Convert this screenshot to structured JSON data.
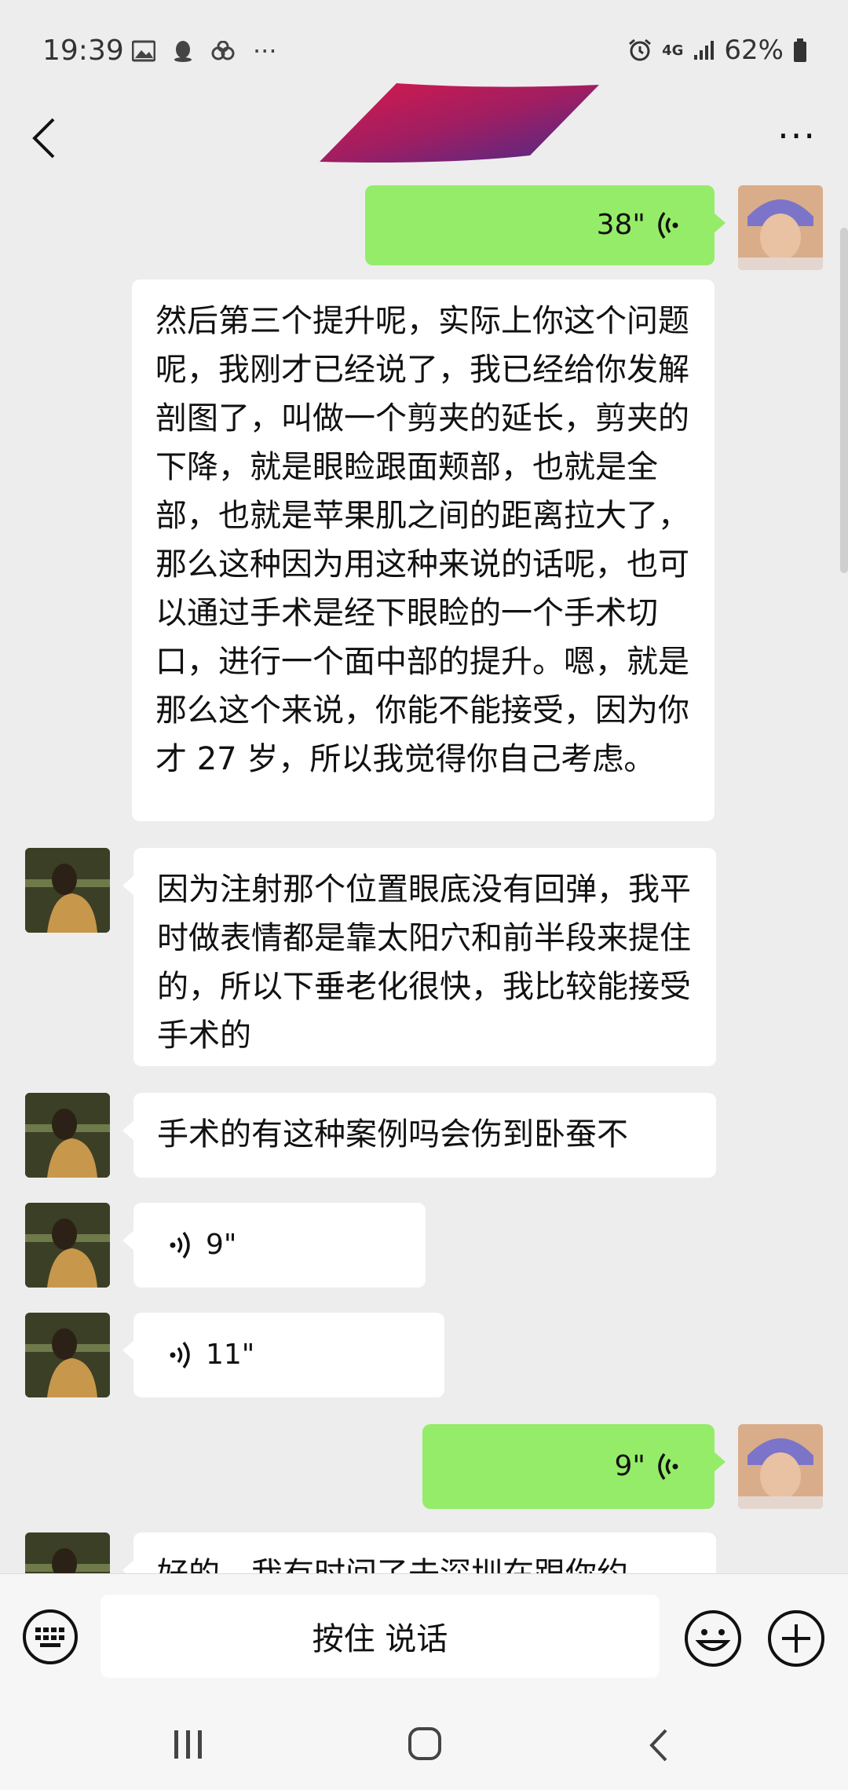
{
  "status_bar": {
    "time": "19:39",
    "network": "4G",
    "battery": "62%",
    "more": "···"
  },
  "header": {
    "more_label": "···"
  },
  "messages": [
    {
      "side": "out",
      "type": "voice",
      "duration": "38\""
    },
    {
      "side": "out",
      "type": "text",
      "text": "然后第三个提升呢，实际上你这个问题呢，我刚才已经说了，我已经给你发解剖图了，叫做一个剪夹的延长，剪夹的下降，就是眼睑跟面颊部，也就是全部，也就是苹果肌之间的距离拉大了，那么这种因为用这种来说的话呢，也可以通过手术是经下眼睑的一个手术切口，进行一个面中部的提升。嗯，就是那么这个来说，你能不能接受，因为你才 27 岁，所以我觉得你自己考虑。"
    },
    {
      "side": "in",
      "type": "text",
      "text": "因为注射那个位置眼底没有回弹，我平时做表情都是靠太阳穴和前半段来提住的，所以下垂老化很快，我比较能接受手术的"
    },
    {
      "side": "in",
      "type": "text",
      "text": "手术的有这种案例吗会伤到卧蚕不"
    },
    {
      "side": "in",
      "type": "voice",
      "duration": "9\""
    },
    {
      "side": "in",
      "type": "voice",
      "duration": "11\""
    },
    {
      "side": "out",
      "type": "voice",
      "duration": "9\""
    },
    {
      "side": "in",
      "type": "text",
      "text": "好的，我有时间了去深圳在跟你约"
    }
  ],
  "input_bar": {
    "hold_to_talk": "按住 说话"
  },
  "colors": {
    "background": "#ededed",
    "outgoing_bubble": "#95ec69",
    "incoming_bubble": "#ffffff"
  },
  "icons": [
    "back-icon",
    "more-icon",
    "voice-wave-icon",
    "keyboard-icon",
    "emoji-icon",
    "plus-icon"
  ]
}
